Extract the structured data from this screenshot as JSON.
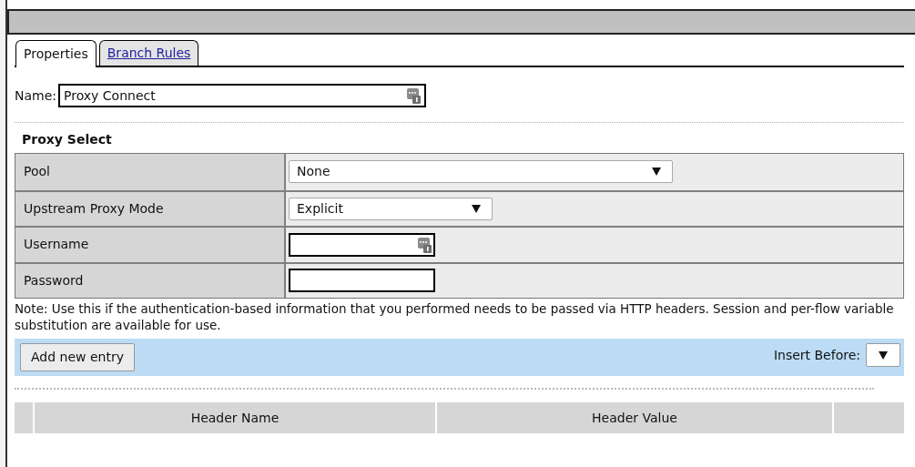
{
  "tabs": [
    {
      "label": "Properties",
      "selected": true
    },
    {
      "label": "Branch Rules",
      "selected": false
    }
  ],
  "name_field": {
    "label": "Name:",
    "value": "Proxy Connect"
  },
  "section": {
    "title": "Proxy Select"
  },
  "rows": [
    {
      "label": "Pool",
      "kind": "select",
      "value": "None",
      "wide": true
    },
    {
      "label": "Upstream Proxy Mode",
      "kind": "select",
      "value": "Explicit",
      "wide": false
    },
    {
      "label": "Username",
      "kind": "text"
    },
    {
      "label": "Password",
      "kind": "password"
    }
  ],
  "note": "Note: Use this if the authentication-based information that you performed needs to be passed via HTTP headers. Session and per-flow variable substitution are available for use.",
  "toolbar": {
    "button": "Add new entry",
    "insert_label": "Insert Before:"
  },
  "header_table": {
    "columns": [
      "Header Name",
      "Header Value"
    ]
  }
}
